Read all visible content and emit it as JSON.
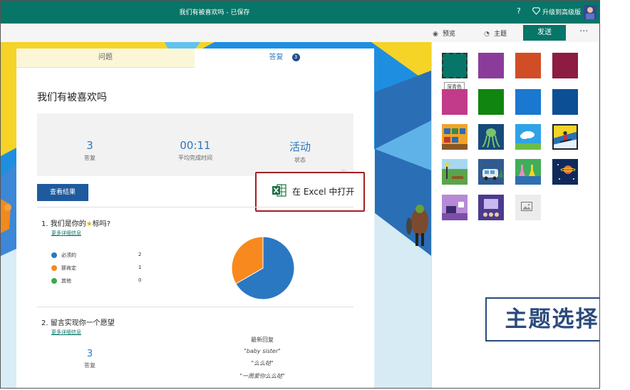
{
  "topbar": {
    "title": "我们有被喜欢吗 - 已保存",
    "help": "?",
    "upgrade": "升级到高级版",
    "bg_color": "#077568"
  },
  "actions": {
    "preview": "预览",
    "theme": "主题",
    "send": "发送",
    "more": "···"
  },
  "tabs": {
    "questions": "问题",
    "responses": "答复",
    "response_count": "3"
  },
  "form": {
    "title": "我们有被喜欢吗",
    "stats": [
      {
        "value": "3",
        "label": "答复"
      },
      {
        "value": "00:11",
        "label": "平均完成时间"
      },
      {
        "value": "活动",
        "label": "状态"
      }
    ],
    "dots": "···",
    "view_results": "查看结果",
    "open_excel": "在 Excel 中打开"
  },
  "q1": {
    "number": "1.",
    "text_before": "我们是你的",
    "text_after": "标吗?",
    "more_info": "更多详细信息",
    "options": [
      {
        "label": "必须的",
        "count": "2",
        "color": "#2b78c2"
      },
      {
        "label": "那肯定",
        "count": "1",
        "color": "#f7891e"
      },
      {
        "label": "其他",
        "count": "0",
        "color": "#3aa84a"
      }
    ]
  },
  "chart_data": {
    "type": "pie",
    "categories": [
      "必须的",
      "那肯定",
      "其他"
    ],
    "values": [
      2,
      1,
      0
    ],
    "colors": [
      "#2b78c2",
      "#f7891e",
      "#3aa84a"
    ]
  },
  "q2": {
    "number": "2.",
    "text": "留言实现你一个愿望",
    "more_info": "更多详细信息",
    "count": "3",
    "count_label": "答复",
    "latest_header": "最新回复",
    "responses": [
      "\"baby sister\"",
      "\"么么哒\"",
      "\"一周爱你么么哒\""
    ]
  },
  "panel": {
    "tooltip": "深青色",
    "colors": [
      "#077568",
      "#8b3c9b",
      "#d14d26",
      "#8c1c41",
      "#c23a8a",
      "#10850f",
      "#1a78d0",
      "#0c4f95"
    ]
  },
  "callout": "主题选择"
}
